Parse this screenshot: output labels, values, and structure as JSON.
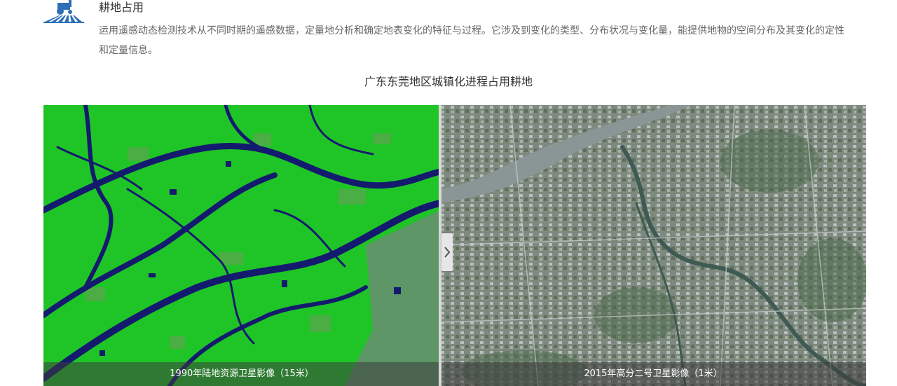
{
  "section": {
    "title": "耕地占用",
    "description": "运用遥感动态检测技术从不同时期的遥感数据，定量地分析和确定地表变化的特征与过程。它涉及到变化的类型、分布状况与变化量，能提供地物的空间分布及其变化的定性和定量信息。",
    "icon": "farmland-tractor-icon",
    "icon_color": "#2f6fb5"
  },
  "comparison": {
    "title": "广东东莞地区城镇化进程占用耕地",
    "left_caption": "1990年陆地资源卫星影像（15米）",
    "right_caption": "2015年高分二号卫星影像（1米）",
    "handle_icon": "chevron-right-icon",
    "colors": {
      "left_vegetation": "#1fc526",
      "left_water": "#141a6e",
      "right_urban": "#7e8a7e",
      "right_river": "#8a9696"
    }
  }
}
